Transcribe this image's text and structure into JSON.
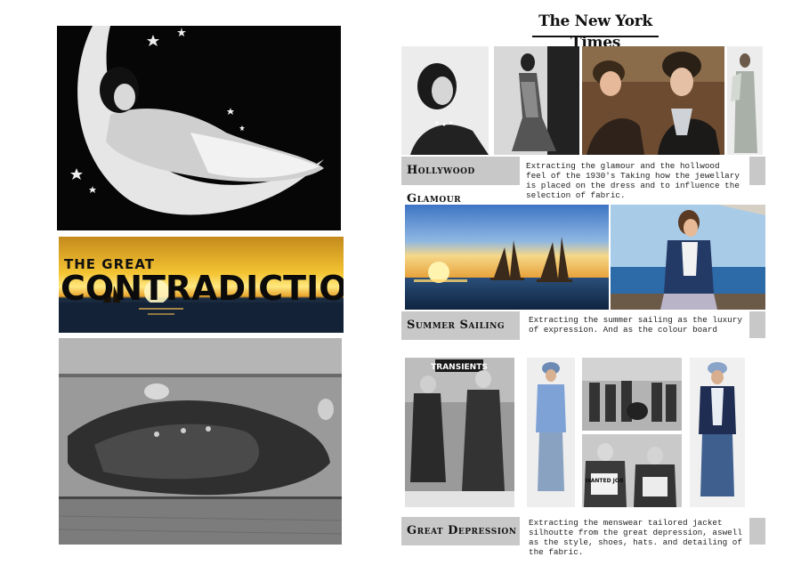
{
  "left_page": {
    "banner": {
      "line1": "THE GREAT",
      "line2": "CONTRADICTION"
    }
  },
  "right_page": {
    "masthead": "The New York Times",
    "sections": [
      {
        "label": "Hollywood Glamour",
        "description": "Extracting the glamour and the hollwood feel of the 1930's Taking how the jewellary is placed on the dress and to influence the selection of fabric."
      },
      {
        "label": "Summer Sailing",
        "description": "Extracting the summer sailing as the luxury of expression. And as the colour board"
      },
      {
        "label": "Great Depression",
        "description": "Extracting the menswear tailored jacket silhoutte from the great depression, aswell as the style, shoes, hats. and detailing of the fabric."
      }
    ],
    "photo_signs": {
      "transients": "TRANSIENTS",
      "wanted_job": "WANTED JOB"
    }
  },
  "colors": {
    "label_grey": "#c8c8c8",
    "sunset_gold": "#f4c432",
    "sea_blue": "#1b4f86"
  }
}
